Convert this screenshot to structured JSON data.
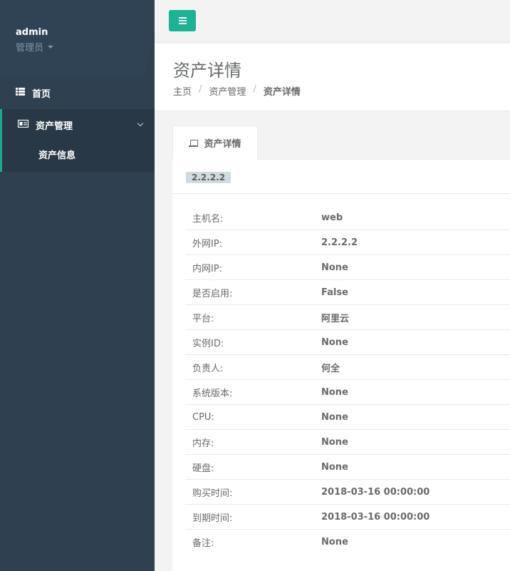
{
  "sidebar": {
    "profile": {
      "name": "admin",
      "role": "管理员"
    },
    "nav": {
      "home": {
        "label": "首页",
        "icon": "th-list-icon"
      },
      "asset": {
        "label": "资产管理",
        "icon": "id-card-icon"
      },
      "asset_sub": [
        {
          "label": "资产信息"
        }
      ]
    }
  },
  "header": {
    "menu_icon": "hamburger-icon"
  },
  "heading": {
    "title": "资产详情",
    "breadcrumb": [
      "主页",
      "资产管理",
      "资产详情"
    ]
  },
  "tab": {
    "label": "资产详情",
    "icon": "laptop-icon"
  },
  "detail": {
    "badge": "2.2.2.2",
    "rows": [
      {
        "label": "主机名:",
        "value": "web"
      },
      {
        "label": "外网IP:",
        "value": "2.2.2.2"
      },
      {
        "label": "内网IP:",
        "value": "None"
      },
      {
        "label": "是否启用:",
        "value": "False"
      },
      {
        "label": "平台:",
        "value": "阿里云"
      },
      {
        "label": "实例ID:",
        "value": "None"
      },
      {
        "label": "负责人:",
        "value": "何全"
      },
      {
        "label": "系统版本:",
        "value": "None"
      },
      {
        "label": "CPU:",
        "value": "None"
      },
      {
        "label": "内存:",
        "value": "None"
      },
      {
        "label": "硬盘:",
        "value": "None"
      },
      {
        "label": "购买时间:",
        "value": "2018-03-16 00:00:00"
      },
      {
        "label": "到期时间:",
        "value": "2018-03-16 00:00:00"
      },
      {
        "label": "备注:",
        "value": "None"
      }
    ]
  },
  "colors": {
    "accent": "#1ab394",
    "sidebar": "#2f4050",
    "sidebar_active": "#293846"
  }
}
